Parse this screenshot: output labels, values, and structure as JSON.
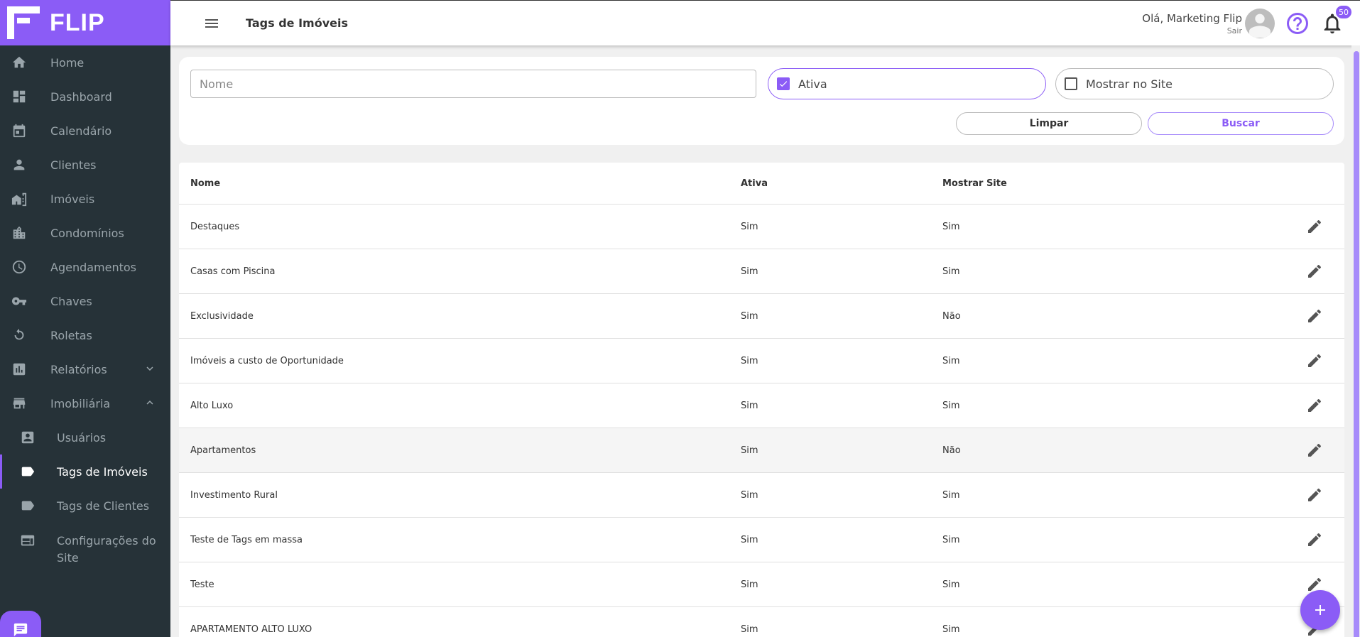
{
  "brand": {
    "name": "FLIP"
  },
  "header": {
    "title": "Tags de Imóveis",
    "greeting": "Olá, Marketing Flip",
    "logout": "Sair",
    "notification_count": "50"
  },
  "sidebar": {
    "items": [
      {
        "label": "Home",
        "icon": "home-icon"
      },
      {
        "label": "Dashboard",
        "icon": "dashboard-icon"
      },
      {
        "label": "Calendário",
        "icon": "calendar-icon"
      },
      {
        "label": "Clientes",
        "icon": "person-icon"
      },
      {
        "label": "Imóveis",
        "icon": "property-icon"
      },
      {
        "label": "Condomínios",
        "icon": "building-icon"
      },
      {
        "label": "Agendamentos",
        "icon": "clock-icon"
      },
      {
        "label": "Chaves",
        "icon": "key-icon"
      },
      {
        "label": "Roletas",
        "icon": "roulette-icon"
      },
      {
        "label": "Relatórios",
        "icon": "chart-icon"
      },
      {
        "label": "Imobiliária",
        "icon": "store-icon"
      }
    ],
    "subitems": [
      {
        "label": "Usuários",
        "icon": "user-card-icon"
      },
      {
        "label": "Tags de Imóveis",
        "icon": "tag-icon"
      },
      {
        "label": "Tags de Clientes",
        "icon": "tag-icon"
      },
      {
        "label": "Configurações do Site",
        "icon": "web-icon"
      }
    ]
  },
  "filters": {
    "name_placeholder": "Nome",
    "name_value": "",
    "active_label": "Ativa",
    "active_checked": true,
    "show_site_label": "Mostrar no Site",
    "show_site_checked": false,
    "clear_label": "Limpar",
    "search_label": "Buscar"
  },
  "table": {
    "headers": {
      "name": "Nome",
      "active": "Ativa",
      "show_site": "Mostrar Site"
    },
    "rows": [
      {
        "name": "Destaques",
        "active": "Sim",
        "show_site": "Sim"
      },
      {
        "name": "Casas com Piscina",
        "active": "Sim",
        "show_site": "Sim"
      },
      {
        "name": "Exclusividade",
        "active": "Sim",
        "show_site": "Não"
      },
      {
        "name": "Imóveis a custo de Oportunidade",
        "active": "Sim",
        "show_site": "Sim"
      },
      {
        "name": "Alto Luxo",
        "active": "Sim",
        "show_site": "Sim"
      },
      {
        "name": "Apartamentos",
        "active": "Sim",
        "show_site": "Não"
      },
      {
        "name": "Investimento Rural",
        "active": "Sim",
        "show_site": "Sim"
      },
      {
        "name": "Teste de Tags em massa",
        "active": "Sim",
        "show_site": "Sim"
      },
      {
        "name": "Teste",
        "active": "Sim",
        "show_site": "Sim"
      },
      {
        "name": "APARTAMENTO ALTO LUXO",
        "active": "Sim",
        "show_site": "Sim"
      }
    ]
  },
  "colors": {
    "accent": "#8b5cf6",
    "sidebar_bg": "#263238"
  }
}
